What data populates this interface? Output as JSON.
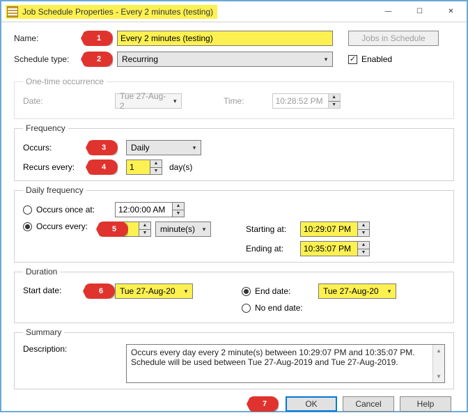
{
  "window": {
    "title": "Job Schedule Properties - Every 2 minutes (testing)"
  },
  "callouts": {
    "c1": "1",
    "c2": "2",
    "c3": "3",
    "c4": "4",
    "c5": "5",
    "c6": "6",
    "c7": "7"
  },
  "labels": {
    "name": "Name:",
    "schedule_type": "Schedule type:",
    "jobs_in_schedule": "Jobs in Schedule",
    "enabled": "Enabled",
    "one_time": "One-time occurrence",
    "date": "Date:",
    "time": "Time:",
    "frequency": "Frequency",
    "occurs": "Occurs:",
    "recurs_every": "Recurs every:",
    "days_suffix": "day(s)",
    "daily_freq": "Daily frequency",
    "occurs_once": "Occurs once at:",
    "occurs_every": "Occurs every:",
    "minutes": "minute(s)",
    "starting_at": "Starting at:",
    "ending_at": "Ending at:",
    "duration": "Duration",
    "start_date": "Start date:",
    "end_date": "End date:",
    "no_end_date": "No end date:",
    "summary": "Summary",
    "description": "Description:",
    "ok": "OK",
    "cancel": "Cancel",
    "help": "Help"
  },
  "values": {
    "name": "Every 2 minutes (testing)",
    "schedule_type": "Recurring",
    "one_time_date": "Tue  27-Aug-2",
    "one_time_time": "10:28:52 PM",
    "occurs": "Daily",
    "recurs_every": "1",
    "occurs_once_time": "12:00:00 AM",
    "occurs_every_n": "2",
    "starting_at": "10:29:07 PM",
    "ending_at": "10:35:07 PM",
    "start_date": "Tue  27-Aug-20",
    "end_date": "Tue  27-Aug-20",
    "description": "Occurs every day every 2 minute(s) between 10:29:07 PM and 10:35:07 PM. Schedule will be used between Tue 27-Aug-2019 and Tue 27-Aug-2019."
  },
  "state": {
    "enabled": true,
    "daily_mode": "every",
    "duration_mode": "end_date"
  }
}
